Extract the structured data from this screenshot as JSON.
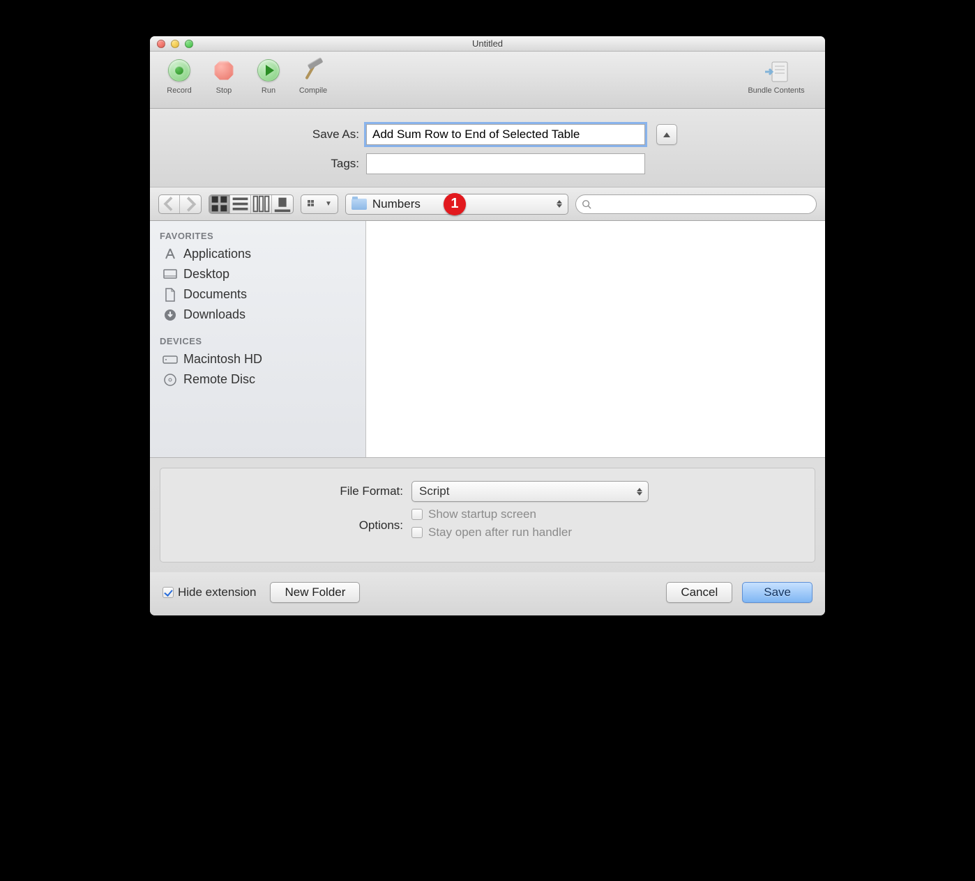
{
  "window": {
    "title": "Untitled"
  },
  "toolbar": {
    "record": "Record",
    "stop": "Stop",
    "run": "Run",
    "compile": "Compile",
    "bundle": "Bundle Contents"
  },
  "save_sheet": {
    "saveas_label": "Save As:",
    "saveas_value": "Add Sum Row to End of Selected Table",
    "tags_label": "Tags:",
    "tags_value": ""
  },
  "nav": {
    "folder": "Numbers",
    "search_placeholder": ""
  },
  "annotation": {
    "badge": "1"
  },
  "sidebar": {
    "favorites_header": "FAVORITES",
    "favorites": [
      "Applications",
      "Desktop",
      "Documents",
      "Downloads"
    ],
    "devices_header": "DEVICES",
    "devices": [
      "Macintosh HD",
      "Remote Disc"
    ]
  },
  "options": {
    "format_label": "File Format:",
    "format_value": "Script",
    "options_label": "Options:",
    "show_startup": "Show startup screen",
    "stay_open": "Stay open after run handler"
  },
  "footer": {
    "hide_ext": "Hide extension",
    "new_folder": "New Folder",
    "cancel": "Cancel",
    "save": "Save"
  }
}
